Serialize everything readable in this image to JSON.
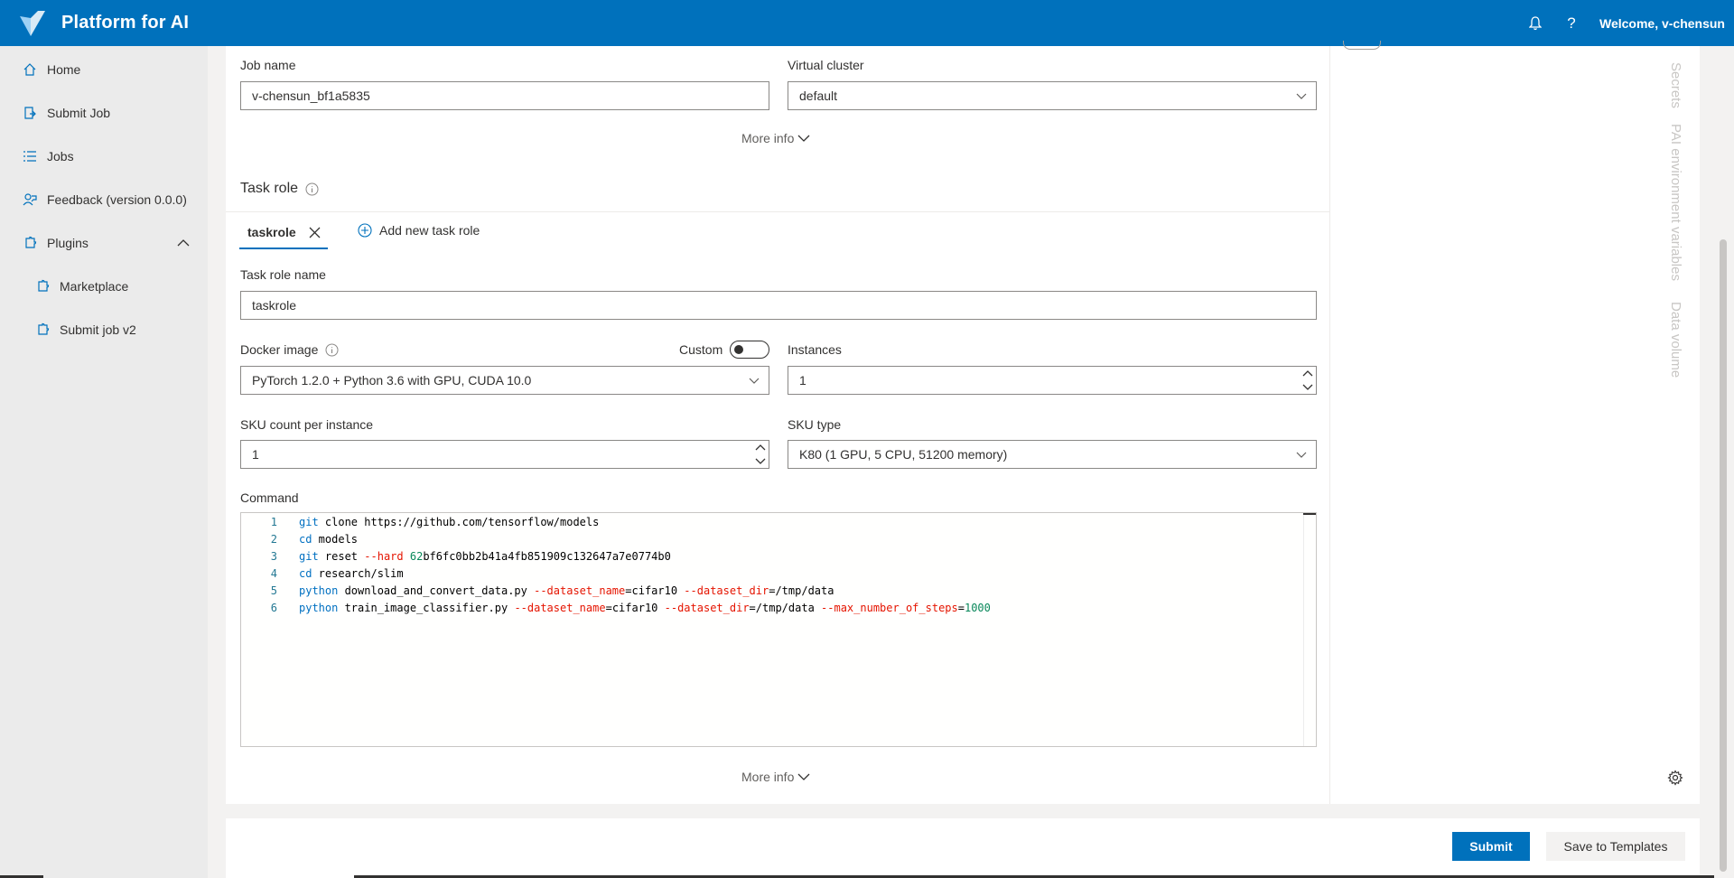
{
  "header": {
    "app_title": "Platform for AI",
    "welcome_text": "Welcome, v-chensun",
    "brand_color": "#0071bc",
    "icons": [
      "logo",
      "bell-icon",
      "help-icon"
    ]
  },
  "sidebar": {
    "items": [
      {
        "label": "Home",
        "icon": "home-icon"
      },
      {
        "label": "Submit Job",
        "icon": "submit-job-icon"
      },
      {
        "label": "Jobs",
        "icon": "jobs-list-icon"
      },
      {
        "label": "Feedback (version 0.0.0)",
        "icon": "feedback-icon"
      },
      {
        "label": "Plugins",
        "icon": "plugin-icon",
        "expanded": true
      },
      {
        "label": "Marketplace",
        "icon": "plugin-icon"
      },
      {
        "label": "Submit job v2",
        "icon": "plugin-icon"
      }
    ]
  },
  "form": {
    "job_name_label": "Job name",
    "job_name_value": "v-chensun_bf1a5835",
    "virtual_cluster_label": "Virtual cluster",
    "virtual_cluster_value": "default",
    "more_info": "More info",
    "task_role_title": "Task role",
    "tab_label": "taskrole",
    "add_task_role": "Add new task role",
    "task_role_name_label": "Task role name",
    "task_role_name_value": "taskrole",
    "docker_image_label": "Docker image",
    "custom_label": "Custom",
    "docker_image_value": "PyTorch 1.2.0 + Python 3.6 with GPU, CUDA 10.0",
    "instances_label": "Instances",
    "instances_value": "1",
    "sku_count_label": "SKU count per instance",
    "sku_count_value": "1",
    "sku_type_label": "SKU type",
    "sku_type_value": "K80 (1 GPU, 5 CPU, 51200 memory)",
    "command_label": "Command",
    "command_lines": [
      {
        "n": "1",
        "text": "git clone https://github.com/tensorflow/models"
      },
      {
        "n": "2",
        "text": "cd models"
      },
      {
        "n": "3",
        "text": "git reset --hard 62bf6fc0bb2b41a4fb851909c132647a7e0774b0"
      },
      {
        "n": "4",
        "text": "cd research/slim"
      },
      {
        "n": "5",
        "text": "python download_and_convert_data.py --dataset_name=cifar10 --dataset_dir=/tmp/data"
      },
      {
        "n": "6",
        "text": "python train_image_classifier.py --dataset_name=cifar10 --dataset_dir=/tmp/data --max_number_of_steps=1000"
      }
    ]
  },
  "rail": {
    "tabs": [
      "Secrets",
      "PAI environment variables",
      "Data volume"
    ]
  },
  "footer": {
    "submit_label": "Submit",
    "save_label": "Save to Templates"
  }
}
